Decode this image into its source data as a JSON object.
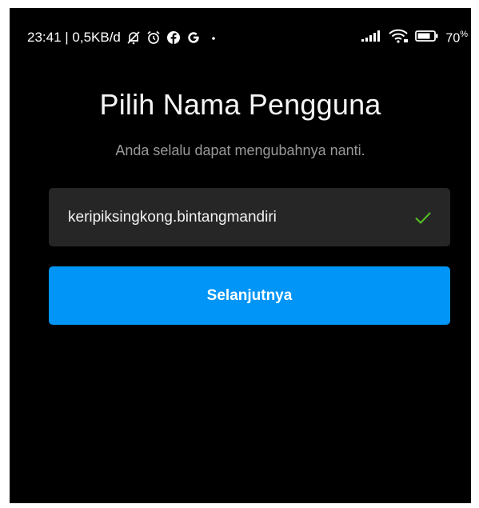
{
  "status_bar": {
    "time_and_speed": "23:41 | 0,5KB/d",
    "icons_left": [
      "notifications-off-icon",
      "alarm-icon",
      "facebook-icon",
      "google-icon",
      "dot-icon"
    ],
    "icons_right": [
      "signal-icon",
      "wifi-icon",
      "battery-icon"
    ],
    "battery_percent": "70",
    "battery_unit": "%"
  },
  "page": {
    "title": "Pilih Nama Pengguna",
    "subtitle": "Anda selalu dapat mengubahnya nanti."
  },
  "username_field": {
    "value": "keripiksingkong.bintangmandiri",
    "valid": true,
    "check_color": "#58c322"
  },
  "next_button": {
    "label": "Selanjutnya",
    "color": "#0095f6"
  },
  "colors": {
    "background": "#000000",
    "field_background": "#262626",
    "subtitle_text": "#9a9a9a"
  }
}
